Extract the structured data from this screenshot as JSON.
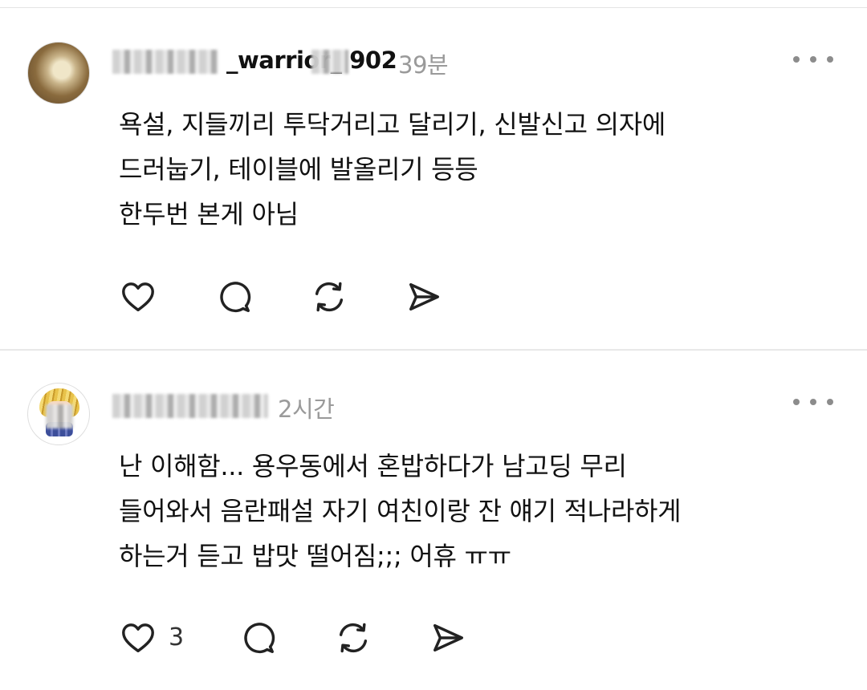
{
  "posts": [
    {
      "username": "***_warrior_**02",
      "username_visible": "_warrior_   902",
      "time": "39분",
      "lines": [
        "욕설, 지들끼리 투닥거리고 달리기, 신발신고 의자에",
        "드러눕기, 테이블에 발올리기 등등",
        "한두번 본게 아님"
      ],
      "like_count": ""
    },
    {
      "username": "",
      "username_visible": "",
      "time": "2시간",
      "lines": [
        "난 이해함... 용우동에서 혼밥하다가 남고딩 무리",
        "들어와서 음란패설 자기 여친이랑 잔 얘기 적나라하게",
        "하는거 듣고 밥맛 떨어짐;;; 어휴 ㅠㅠ"
      ],
      "like_count": "3"
    }
  ],
  "icons": [
    "heart-icon",
    "comment-icon",
    "repost-icon",
    "share-icon",
    "more-icon"
  ],
  "colors": {
    "text": "#111111",
    "meta": "#9a9a9a",
    "icon": "#222222",
    "divider": "#e8e8e8"
  }
}
